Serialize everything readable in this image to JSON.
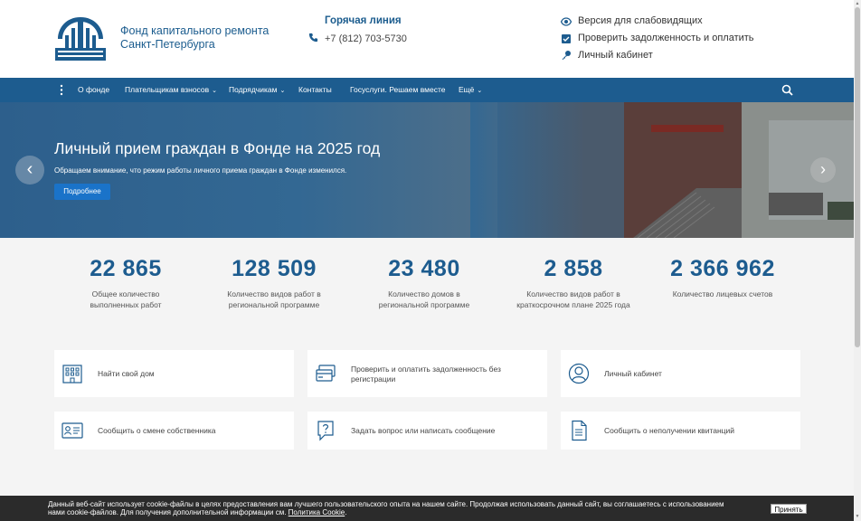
{
  "header": {
    "org_name_line1": "Фонд капитального ремонта",
    "org_name_line2": "Санкт-Петербурга",
    "hotline_title": "Горячая линия",
    "phone": "+7 (812) 703-5730",
    "links": [
      {
        "label": "Версия для слабовидящих",
        "icon": "eye-icon"
      },
      {
        "label": "Проверить задолженность и оплатить",
        "icon": "checkbox-icon"
      },
      {
        "label": "Личный кабинет",
        "icon": "key-icon"
      }
    ]
  },
  "nav": {
    "items": [
      {
        "label": "О фонде",
        "dropdown": false
      },
      {
        "label": "Плательщикам взносов",
        "dropdown": true
      },
      {
        "label": "Подрядчикам",
        "dropdown": true
      },
      {
        "label": "Контакты",
        "dropdown": false
      },
      {
        "label": "Госуслуги. Решаем вместе",
        "dropdown": false
      },
      {
        "label": "Ещё",
        "dropdown": true
      }
    ],
    "caret": "⌄"
  },
  "hero": {
    "title": "Личный прием граждан в Фонде на 2025 год",
    "subtitle": "Обращаем внимание, что режим работы личного приема граждан в Фонде изменился.",
    "button": "Подробнее",
    "prev": "‹",
    "next": "›"
  },
  "stats": [
    {
      "value": "22 865",
      "label": "Общее количество выполненных работ"
    },
    {
      "value": "128 509",
      "label": "Количество видов работ в региональной программе"
    },
    {
      "value": "23 480",
      "label": "Количество домов в региональной программе"
    },
    {
      "value": "2 858",
      "label": "Количество видов работ в краткосрочном плане 2025 года"
    },
    {
      "value": "2 366 962",
      "label": "Количество лицевых счетов"
    }
  ],
  "cards": [
    {
      "label": "Найти свой дом",
      "icon": "building-icon"
    },
    {
      "label": "Проверить и оплатить задолженность без регистрации",
      "icon": "payment-card-icon"
    },
    {
      "label": "Личный кабинет",
      "icon": "user-icon"
    },
    {
      "label": "Сообщить о смене собственника",
      "icon": "id-card-icon"
    },
    {
      "label": "Задать вопрос или написать сообщение",
      "icon": "question-chat-icon"
    },
    {
      "label": "Сообщить о неполучении квитанций",
      "icon": "document-icon"
    }
  ],
  "cookie": {
    "text": "Данный веб-сайт использует cookie-файлы в целях предоставления вам лучшего пользовательского опыта на нашем сайте. Продолжая использовать данный сайт, вы соглашаетесь с использованием нами cookie-файлов. Для получения дополнительной информации см.",
    "link": "Политика Cookie",
    "end": ".",
    "accept": "Принять"
  },
  "colors": {
    "brand": "#1d5c8f",
    "button": "#1a73c9",
    "cookie_bg": "#2b2b2b"
  }
}
